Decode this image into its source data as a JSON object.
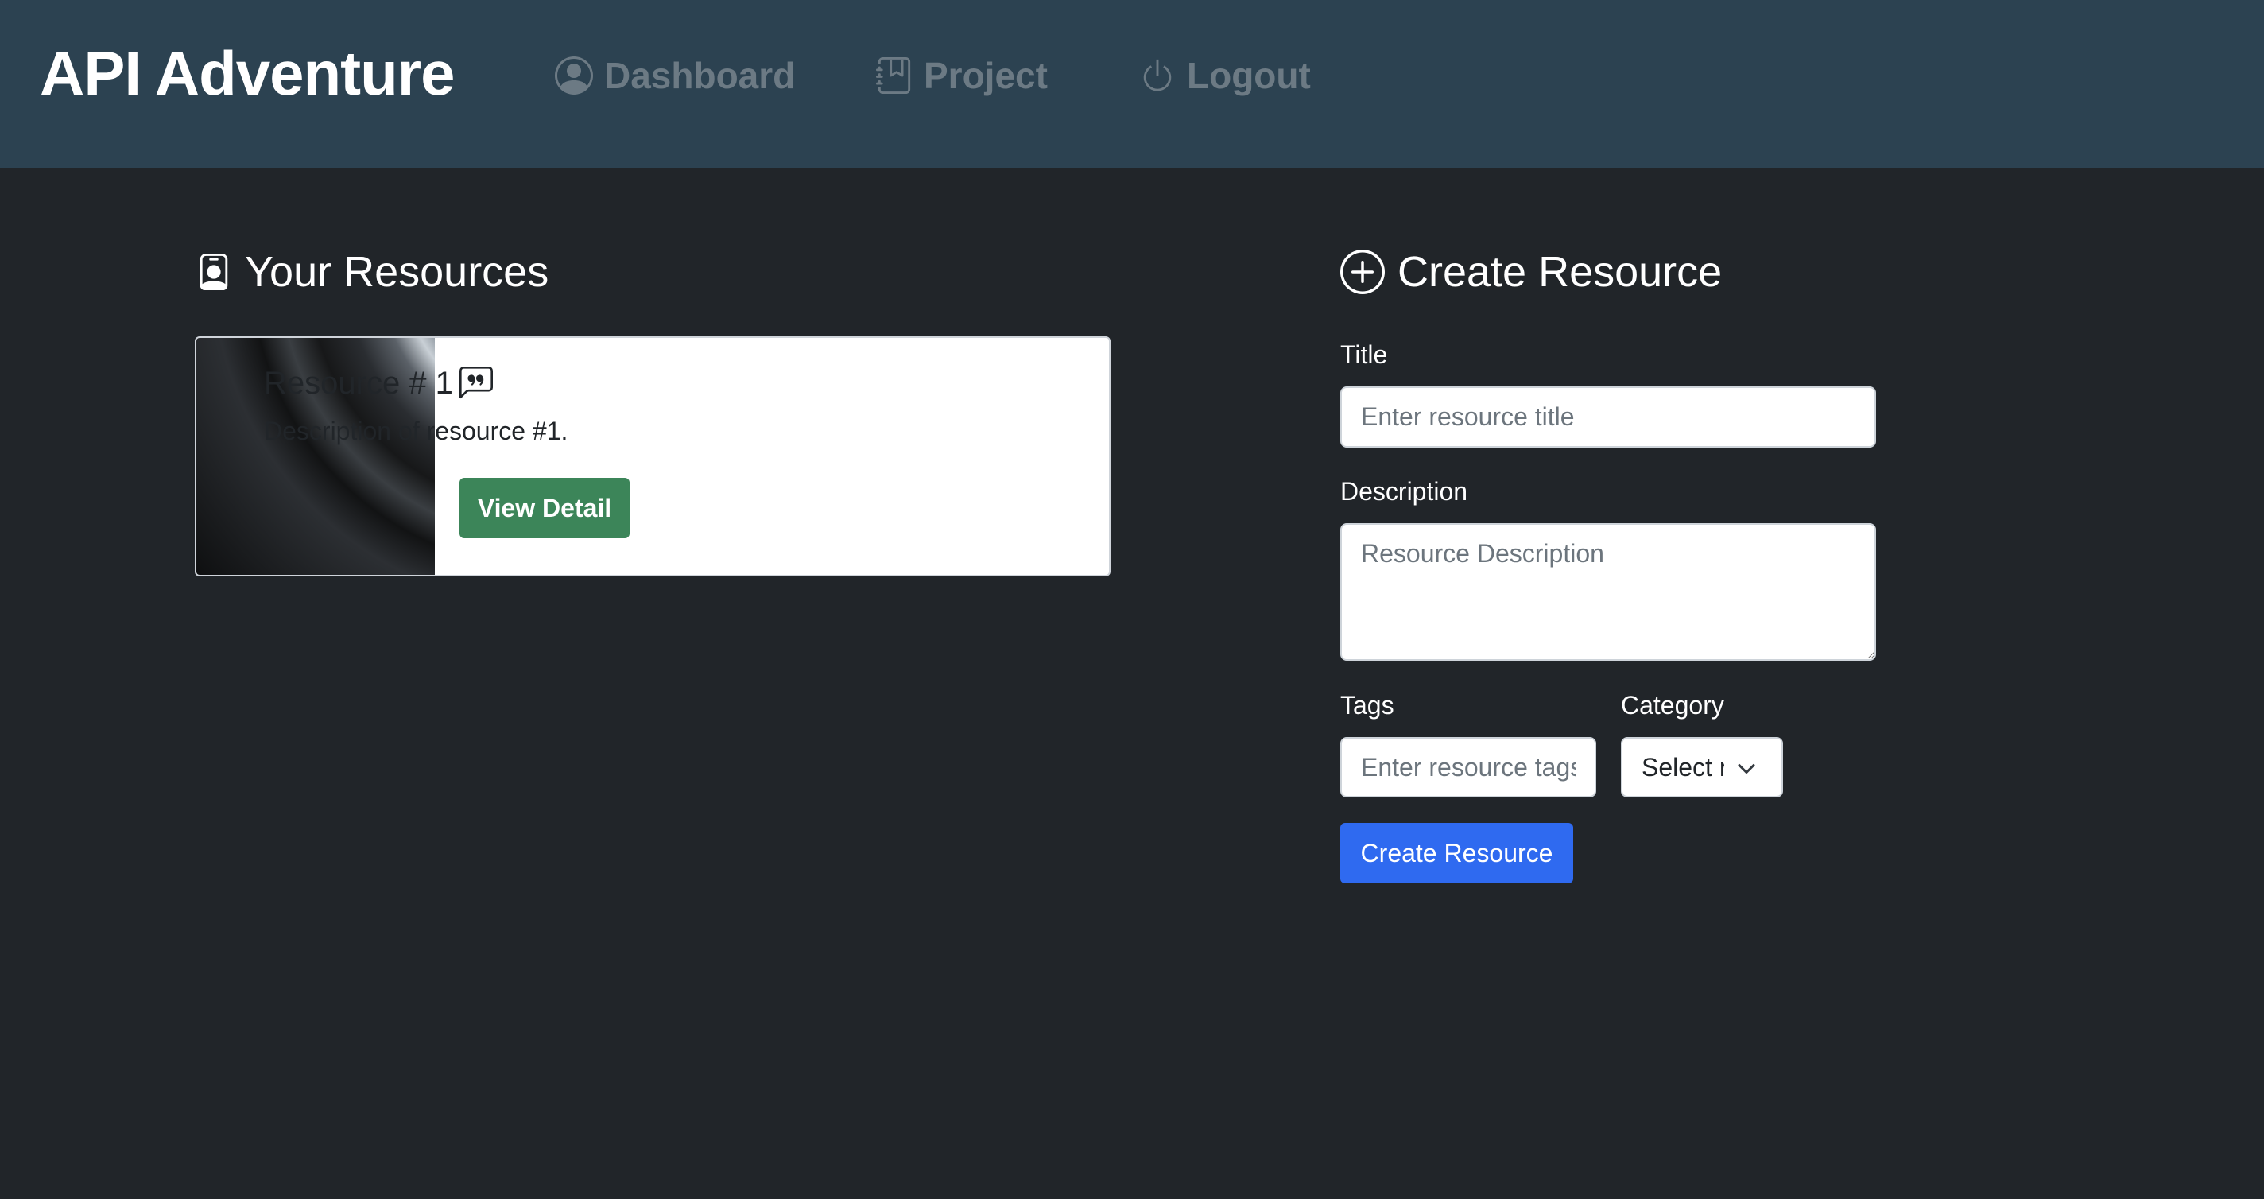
{
  "brand": "API Adventure",
  "nav": {
    "dashboard": {
      "label": "Dashboard",
      "icon": "person-circle-icon"
    },
    "project": {
      "label": "Project",
      "icon": "journal-bookmark-icon"
    },
    "logout": {
      "label": "Logout",
      "icon": "power-icon"
    }
  },
  "resources": {
    "heading": "Your Resources",
    "icon": "person-badge-icon",
    "items": [
      {
        "title": "Resource # 1",
        "title_icon": "chat-quote-icon",
        "description": "Description of resource #1.",
        "button_label": "View Detail",
        "image": "vinyl-record-image"
      }
    ]
  },
  "create": {
    "heading": "Create Resource",
    "icon": "plus-circle-icon",
    "title_label": "Title",
    "title_placeholder": "Enter resource title",
    "description_label": "Description",
    "description_placeholder": "Resource Description",
    "tags_label": "Tags",
    "tags_placeholder": "Enter resource tags",
    "category_label": "Category",
    "category_selected": "Select resource type",
    "submit_label": "Create Resource"
  },
  "colors": {
    "navbar": "#2c4251",
    "background": "#212529",
    "nav_link": "#6c7a84",
    "success": "#3c8559",
    "primary": "#2f6af0"
  }
}
